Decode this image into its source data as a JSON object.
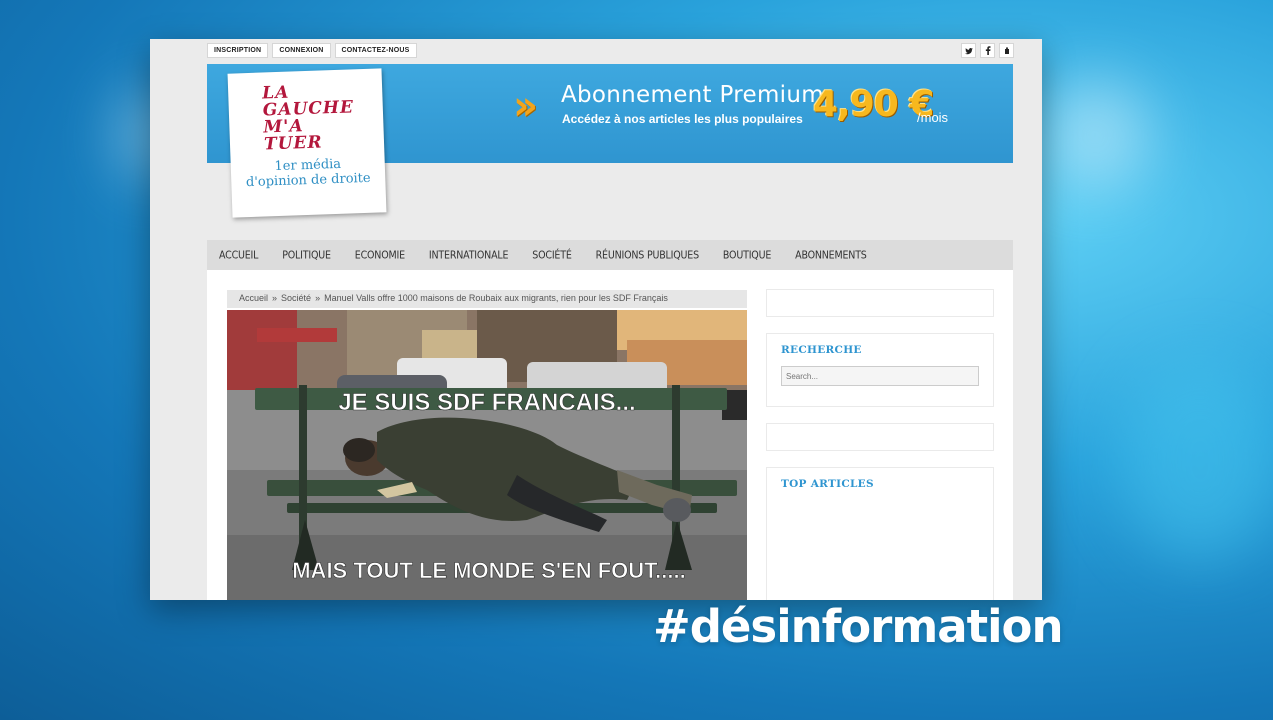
{
  "topbar": {
    "links": [
      "INSCRIPTION",
      "CONNEXION",
      "CONTACTEZ-NOUS"
    ],
    "social_icons": [
      "twitter-icon",
      "facebook-icon",
      "rss-icon"
    ]
  },
  "logo": {
    "main": "LA\nGAUCHE\nM'A\nTUER",
    "sub": "1er média\nd'opinion de droite"
  },
  "promo": {
    "title": "Abonnement Premium",
    "subtitle": "Accédez à nos articles les plus populaires",
    "price": "4,90 €",
    "unit": "/mois"
  },
  "nav": {
    "items": [
      "ACCUEIL",
      "POLITIQUE",
      "ECONOMIE",
      "INTERNATIONALE",
      "SOCIÉTÉ",
      "RÉUNIONS PUBLIQUES",
      "BOUTIQUE",
      "ABONNEMENTS"
    ]
  },
  "breadcrumb": {
    "items": [
      "Accueil",
      "Société",
      "Manuel Valls offre 1000 maisons de Roubaix aux migrants, rien pour les SDF Français"
    ],
    "separator": "»"
  },
  "photo": {
    "caption_top": "JE SUIS   SDF  FRANCAIS...",
    "caption_bottom": "MAIS TOUT LE MONDE S'EN FOUT....."
  },
  "sidebar": {
    "search_title": "RECHERCHE",
    "search_placeholder": "Search...",
    "top_articles_title": "TOP ARTICLES"
  },
  "overlay": {
    "hashtag": "#désinformation"
  },
  "colors": {
    "accent": "#2f95d0",
    "logo_red": "#b3173c",
    "price_gold": "#f7b81e"
  }
}
